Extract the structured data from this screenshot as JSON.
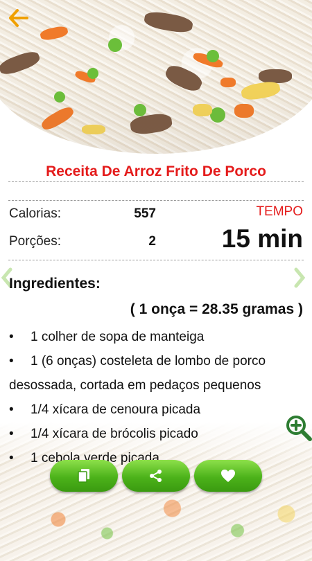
{
  "recipe": {
    "title": "Receita De Arroz Frito De Porco"
  },
  "stats": {
    "calories_label": "Calorias:",
    "calories_value": "557",
    "portions_label": "Porções:",
    "portions_value": "2",
    "time_label": "TEMPO",
    "time_value": "15 min"
  },
  "ingredients": {
    "heading": "Ingredientes:",
    "conversion": "( 1 onça = 28.35 gramas )",
    "items": [
      {
        "first": "1 colher de sopa de manteiga",
        "rest": ""
      },
      {
        "first": "1 (6 onças) costeleta de lombo de porco",
        "rest": "desossada, cortada em pedaços pequenos"
      },
      {
        "first": "1/4 xícara de cenoura picada",
        "rest": ""
      },
      {
        "first": "1/4 xícara de brócolis picado",
        "rest": ""
      },
      {
        "first": "1 cebola verde picada",
        "rest": ""
      }
    ]
  },
  "icons": {
    "back": "back-arrow-icon",
    "copy": "copy-icon",
    "share": "share-icon",
    "favorite": "heart-icon",
    "zoom": "zoom-in-icon",
    "prev": "chevron-left-icon",
    "next": "chevron-right-icon"
  },
  "colors": {
    "title_red": "#e41b1b",
    "button_green": "#4cb21a",
    "back_orange": "#f0a000",
    "zoom_green": "#2e7d32"
  }
}
